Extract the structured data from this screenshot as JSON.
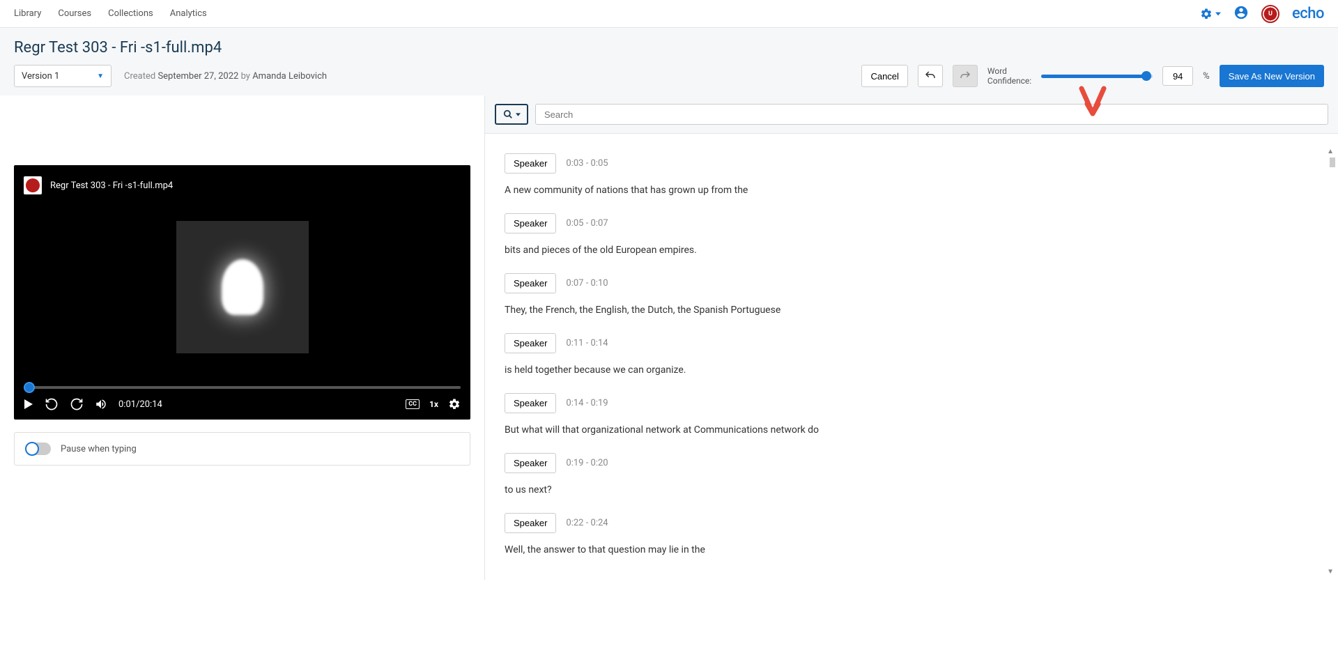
{
  "nav": {
    "links": [
      "Library",
      "Courses",
      "Collections",
      "Analytics"
    ],
    "brand": "echo"
  },
  "page": {
    "title": "Regr Test 303 - Fri -s1-full.mp4",
    "version": "Version 1",
    "created_prefix": "Created",
    "created_date": "September 27, 2022",
    "created_by_prefix": "by",
    "created_by": "Amanda Leibovich"
  },
  "toolbar": {
    "cancel": "Cancel",
    "confidence_label_1": "Word",
    "confidence_label_2": "Confidence:",
    "confidence_value": "94",
    "percent": "%",
    "save": "Save As New Version"
  },
  "video": {
    "title": "Regr Test 303 - Fri -s1-full.mp4",
    "time": "0:01/20:14",
    "speed": "1x",
    "cc": "CC"
  },
  "pause_toggle": "Pause when typing",
  "search": {
    "placeholder": "Search"
  },
  "transcript": [
    {
      "speaker": "Speaker",
      "time": "0:03 - 0:05",
      "text": "A new community of nations that has grown up from the"
    },
    {
      "speaker": "Speaker",
      "time": "0:05 - 0:07",
      "text": "bits and pieces of the old European empires."
    },
    {
      "speaker": "Speaker",
      "time": "0:07 - 0:10",
      "text": "They, the French, the English, the Dutch, the Spanish Portuguese"
    },
    {
      "speaker": "Speaker",
      "time": "0:11 - 0:14",
      "text": "is held together because we can organize."
    },
    {
      "speaker": "Speaker",
      "time": "0:14 - 0:19",
      "text": "But what will that organizational network at Communications network do"
    },
    {
      "speaker": "Speaker",
      "time": "0:19 - 0:20",
      "text": "to us next?"
    },
    {
      "speaker": "Speaker",
      "time": "0:22 - 0:24",
      "text": "Well, the answer to that question may lie in the"
    }
  ]
}
